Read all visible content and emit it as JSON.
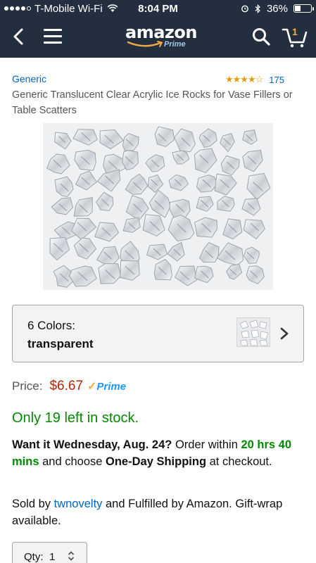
{
  "status_bar": {
    "carrier": "T-Mobile Wi-Fi",
    "time": "8:04 PM",
    "battery": "36%",
    "battery_level": 0.36
  },
  "nav": {
    "logo_text": "amazon",
    "logo_sub": "Prime",
    "cart_count": "1"
  },
  "product": {
    "brand": "Generic",
    "rating_stars": "★★★★☆",
    "review_count": "175",
    "title": "Generic Translucent Clear Acrylic Ice Rocks for Vase Fillers or Table Scatters"
  },
  "variation": {
    "label": "6 Colors:",
    "value": "transparent"
  },
  "price": {
    "label": "Price:",
    "value": "$6.67",
    "prime_check": "✓",
    "prime_text": "Prime"
  },
  "stock": "Only 19 left in stock.",
  "delivery": {
    "part1": "Want it Wednesday, Aug. 24?",
    "part2": " Order within ",
    "countdown": "20 hrs 40 mins",
    "part3": " and choose ",
    "shipping": "One-Day Shipping",
    "part4": " at checkout."
  },
  "seller": {
    "prefix": "Sold by ",
    "name": "twnovelty",
    "suffix": " and Fulfilled by Amazon. Gift-wrap available."
  },
  "quantity": {
    "label": "Qty:",
    "value": "1"
  },
  "colors": {
    "header": "#232f3e",
    "link": "#0066c0",
    "price": "#b12704",
    "stock": "#008a00",
    "star": "#e49b0f",
    "prime": "#1a98ff"
  }
}
